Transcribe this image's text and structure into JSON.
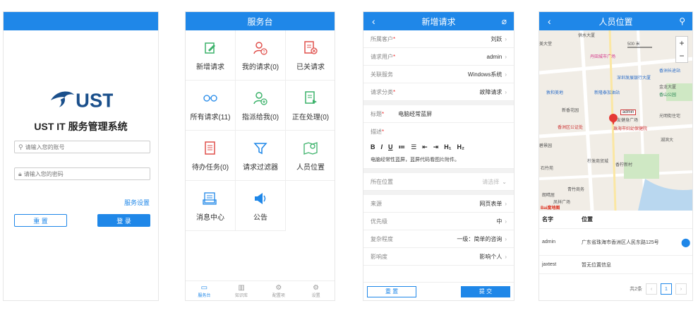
{
  "login": {
    "logo_text": "UST",
    "title": "UST IT 服务管理系统",
    "account_placeholder": "请输入您的账号",
    "password_placeholder": "请输入您的密码",
    "service_settings": "服务设置",
    "reset_label": "重 置",
    "login_label": "登 录",
    "colors": {
      "accent": "#1f87e8"
    }
  },
  "desk": {
    "title": "服务台",
    "items": [
      {
        "label": "新增请求",
        "icon": "edit-icon"
      },
      {
        "label": "我的请求(0)",
        "icon": "user-question-icon"
      },
      {
        "label": "已关请求",
        "icon": "closed-doc-icon"
      },
      {
        "label": "所有请求(11)",
        "icon": "glasses-icon"
      },
      {
        "label": "指派给我(0)",
        "icon": "user-add-icon"
      },
      {
        "label": "正在处理(0)",
        "icon": "doc-play-icon"
      },
      {
        "label": "待办任务(0)",
        "icon": "doc-list-icon"
      },
      {
        "label": "请求过滤器",
        "icon": "filter-icon"
      },
      {
        "label": "人员位置",
        "icon": "map-icon"
      },
      {
        "label": "消息中心",
        "icon": "message-icon"
      },
      {
        "label": "公告",
        "icon": "megaphone-icon"
      }
    ],
    "tabs": [
      {
        "label": "服务台",
        "icon": "monitor-icon"
      },
      {
        "label": "知识库",
        "icon": "book-icon"
      },
      {
        "label": "配置项",
        "icon": "config-icon"
      },
      {
        "label": "设置",
        "icon": "gear-icon"
      }
    ]
  },
  "newreq": {
    "title": "新增请求",
    "back": "‹",
    "rows_top": [
      {
        "label": "所属客户",
        "required": true,
        "value": "刘跃"
      },
      {
        "label": "请求用户",
        "required": true,
        "value": "admin"
      },
      {
        "label": "关联服务",
        "required": false,
        "value": "Windows系统"
      },
      {
        "label": "请求分类",
        "required": true,
        "value": "故障请求"
      }
    ],
    "subject_label": "标题",
    "subject_value": "电脑经常蓝屏",
    "desc_label": "描述",
    "toolbar": [
      "B",
      "I",
      "U",
      "≔",
      "☰",
      "⇤",
      "⇥",
      "H₁",
      "H₂"
    ],
    "desc_text": "电脑经常性蓝屏，蓝屏代码看图片附件。",
    "location_label": "所在位置",
    "location_placeholder": "请选择",
    "rows_bottom": [
      {
        "label": "来源",
        "value": "网页表单"
      },
      {
        "label": "优先级",
        "value": "中"
      },
      {
        "label": "复杂程度",
        "value": "一级：简单的咨询"
      },
      {
        "label": "影响度",
        "value": "影响个人"
      }
    ],
    "reset_label": "重 置",
    "submit_label": "提 交"
  },
  "location": {
    "title": "人员位置",
    "back": "‹",
    "scale": "500 米",
    "marker_label": "admin",
    "map_labels": {
      "l1": "供水大厦",
      "l2": "丹田城市广场",
      "l3": "香洲长途站",
      "l4": "深圳发展银行大厦",
      "l5": "新隆泰加油站",
      "l6": "金龙大厦",
      "l7": "香山公园",
      "l8": "新香花园",
      "l9": "友健身广场",
      "l10": "光明街住宅",
      "l11": "香洲区公证处",
      "l12": "珠海市妇幼保健院",
      "l13": "湖滨大",
      "l14": "柠发商贸城",
      "l15": "石竹苑",
      "l16": "香柠新村",
      "l17": "青竹商务",
      "l18": "朗晴居",
      "l19": "敦和美地",
      "l20": "碧景园",
      "l21": "美大堂",
      "l22": "凤祥广场",
      "baidu": "Bai度地图"
    },
    "col_name": "名字",
    "col_pos": "位置",
    "rows": [
      {
        "name": "admin",
        "pos": "广东省珠海市香洲区人民东路125号"
      },
      {
        "name": "jaxtest",
        "pos": "暂无位置信息"
      }
    ],
    "total": "共2条",
    "page": "1"
  }
}
